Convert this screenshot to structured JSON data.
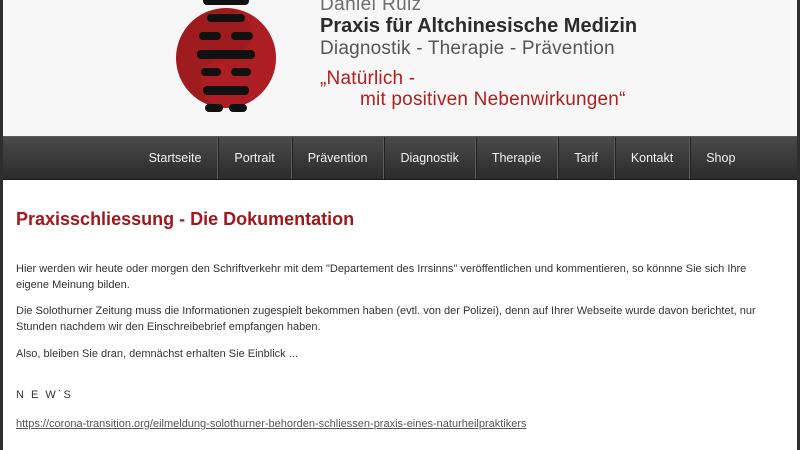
{
  "header": {
    "name": "Daniel Ruiz",
    "title": "Praxis für Altchinesische Medizin",
    "subtitle": "Diagnostik - Therapie - Prävention",
    "slogan_line1": "„Natürlich -",
    "slogan_line2": "mit positiven Nebenwirkungen“"
  },
  "nav": {
    "items": [
      {
        "label": "Startseite"
      },
      {
        "label": "Portrait"
      },
      {
        "label": "Prävention"
      },
      {
        "label": "Diagnostik"
      },
      {
        "label": "Therapie"
      },
      {
        "label": "Tarif"
      },
      {
        "label": "Kontakt"
      },
      {
        "label": "Shop"
      }
    ]
  },
  "main": {
    "title": "Praxisschliessung - Die Dokumentation",
    "paragraphs": [
      "Hier werden wir heute oder morgen den Schriftverkehr mit dem \"Departement des Irrsinns\" veröffentlichen und kommentieren, so könnne Sie sich Ihre eigene Meinung bilden.",
      "Die Solothurner Zeitung muss die Informationen zugespielt bekommen haben (evtl. von der Polizei), denn auf Ihrer Webseite wurde davon berichtet, nur Stunden nachdem wir den Einschreibebrief empfangen haben.",
      "Also, bleiben Sie dran, demnächst erhalten Sie Einblick ..."
    ],
    "news_heading": "N E W`S",
    "news_link": "https://corona-transition.org/eilmeldung-solothurner-behorden-schliessen-praxis-eines-naturheilpraktikers"
  },
  "colors": {
    "accent": "#a3171c",
    "logo_red": "#9e1b1e",
    "nav_bg": "#3a3a3a"
  }
}
